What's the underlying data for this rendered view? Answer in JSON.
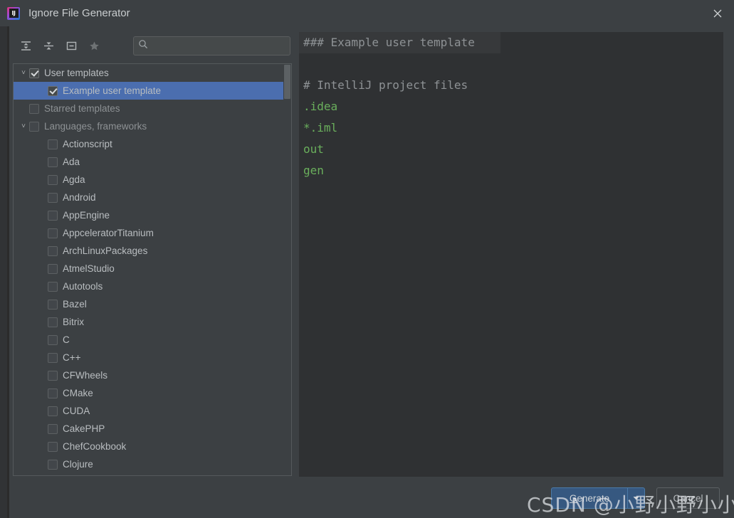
{
  "window": {
    "title": "Ignore File Generator",
    "icon": "intellij-idea-logo",
    "icon_text": "IJ",
    "close_label": "✕"
  },
  "toolbar": {
    "buttons": [
      {
        "name": "expand-all-icon",
        "tooltip": "Expand All"
      },
      {
        "name": "collapse-all-icon",
        "tooltip": "Collapse All"
      },
      {
        "name": "collapse-box-icon",
        "tooltip": "Collapse"
      },
      {
        "name": "star-icon",
        "tooltip": "Starred"
      }
    ]
  },
  "search": {
    "value": "",
    "placeholder": "",
    "icon": "search-icon"
  },
  "tree": {
    "scrollbar": {
      "visible": true,
      "thumb_top": 1,
      "thumb_height": 48
    },
    "rows": [
      {
        "label": "User templates",
        "indent": 0,
        "chevron": "˅",
        "checked": true,
        "selected": false,
        "style": "bright"
      },
      {
        "label": "Example user template",
        "indent": 1,
        "chevron": "",
        "checked": true,
        "selected": true,
        "style": "bright"
      },
      {
        "label": "Starred templates",
        "indent": 0,
        "chevron": "",
        "checked": false,
        "selected": false,
        "style": "dim"
      },
      {
        "label": "Languages, frameworks",
        "indent": 0,
        "chevron": "˅",
        "checked": false,
        "selected": false,
        "style": "dim"
      },
      {
        "label": "Actionscript",
        "indent": 1,
        "chevron": "",
        "checked": false,
        "selected": false,
        "style": "bright"
      },
      {
        "label": "Ada",
        "indent": 1,
        "chevron": "",
        "checked": false,
        "selected": false,
        "style": "bright"
      },
      {
        "label": "Agda",
        "indent": 1,
        "chevron": "",
        "checked": false,
        "selected": false,
        "style": "bright"
      },
      {
        "label": "Android",
        "indent": 1,
        "chevron": "",
        "checked": false,
        "selected": false,
        "style": "bright"
      },
      {
        "label": "AppEngine",
        "indent": 1,
        "chevron": "",
        "checked": false,
        "selected": false,
        "style": "bright"
      },
      {
        "label": "AppceleratorTitanium",
        "indent": 1,
        "chevron": "",
        "checked": false,
        "selected": false,
        "style": "bright"
      },
      {
        "label": "ArchLinuxPackages",
        "indent": 1,
        "chevron": "",
        "checked": false,
        "selected": false,
        "style": "bright"
      },
      {
        "label": "AtmelStudio",
        "indent": 1,
        "chevron": "",
        "checked": false,
        "selected": false,
        "style": "bright"
      },
      {
        "label": "Autotools",
        "indent": 1,
        "chevron": "",
        "checked": false,
        "selected": false,
        "style": "bright"
      },
      {
        "label": "Bazel",
        "indent": 1,
        "chevron": "",
        "checked": false,
        "selected": false,
        "style": "bright"
      },
      {
        "label": "Bitrix",
        "indent": 1,
        "chevron": "",
        "checked": false,
        "selected": false,
        "style": "bright"
      },
      {
        "label": "C",
        "indent": 1,
        "chevron": "",
        "checked": false,
        "selected": false,
        "style": "bright"
      },
      {
        "label": "C++",
        "indent": 1,
        "chevron": "",
        "checked": false,
        "selected": false,
        "style": "bright"
      },
      {
        "label": "CFWheels",
        "indent": 1,
        "chevron": "",
        "checked": false,
        "selected": false,
        "style": "bright"
      },
      {
        "label": "CMake",
        "indent": 1,
        "chevron": "",
        "checked": false,
        "selected": false,
        "style": "bright"
      },
      {
        "label": "CUDA",
        "indent": 1,
        "chevron": "",
        "checked": false,
        "selected": false,
        "style": "bright"
      },
      {
        "label": "CakePHP",
        "indent": 1,
        "chevron": "",
        "checked": false,
        "selected": false,
        "style": "bright"
      },
      {
        "label": "ChefCookbook",
        "indent": 1,
        "chevron": "",
        "checked": false,
        "selected": false,
        "style": "bright"
      },
      {
        "label": "Clojure",
        "indent": 1,
        "chevron": "",
        "checked": false,
        "selected": false,
        "style": "bright"
      }
    ]
  },
  "preview": {
    "lines": [
      {
        "text": "### Example user template",
        "kind": "comment",
        "current": true
      },
      {
        "text": "",
        "kind": "comment",
        "current": false
      },
      {
        "text": "# IntelliJ project files",
        "kind": "comment",
        "current": false
      },
      {
        "text": ".idea",
        "kind": "entry",
        "current": false
      },
      {
        "text": "*.iml",
        "kind": "entry",
        "current": false
      },
      {
        "text": "out",
        "kind": "entry",
        "current": false
      },
      {
        "text": "gen",
        "kind": "entry",
        "current": false
      }
    ]
  },
  "footer": {
    "generate_label_before": "G",
    "generate_label_after": "enerate",
    "generate_dropdown_icon": "chevron-down-icon",
    "cancel_label": "Cancel"
  },
  "watermark": {
    "text": "CSDN @小野小野小小野"
  },
  "colors": {
    "window_bg": "#3c4043",
    "panel_bg": "#2f3133",
    "selection": "#4b6eaf",
    "accent_button": "#365880",
    "entry_green": "#6aaf5c",
    "comment_gray": "#8e9295"
  }
}
